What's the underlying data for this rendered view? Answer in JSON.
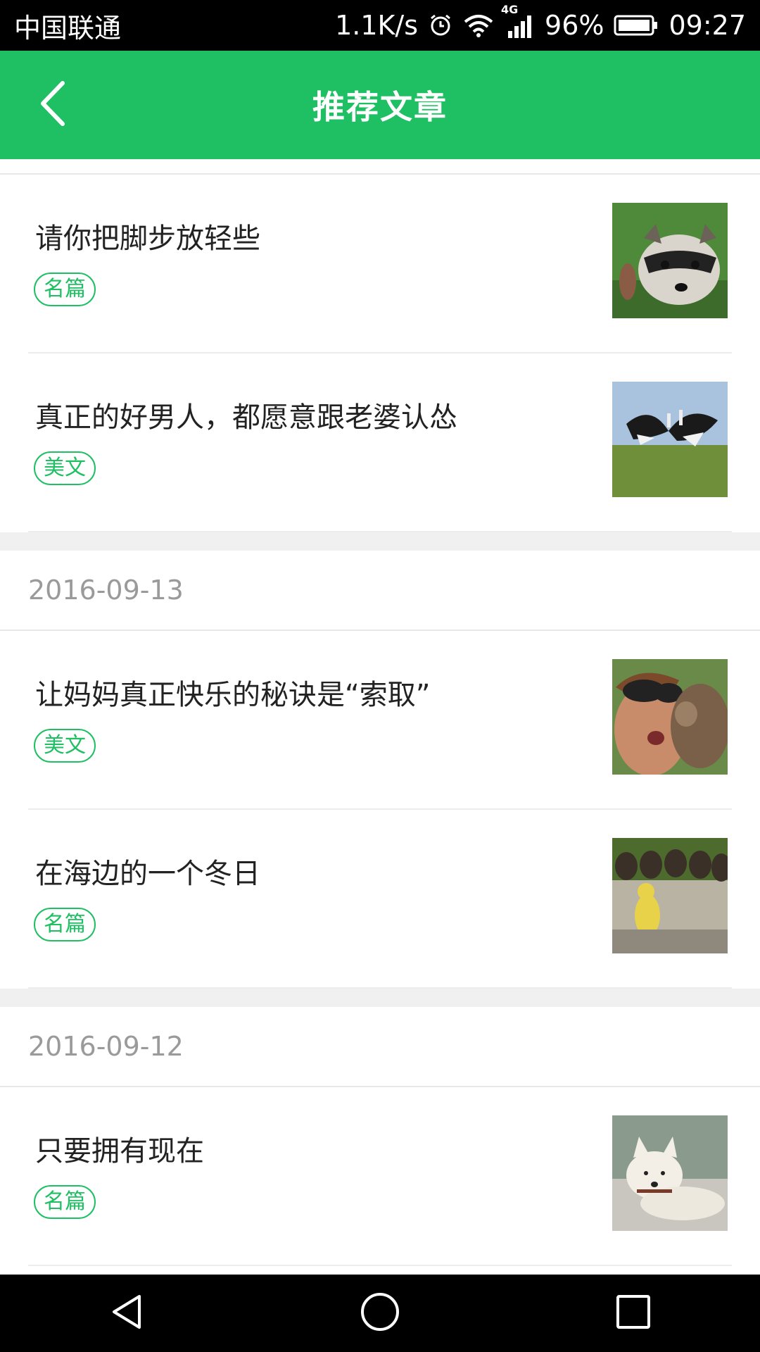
{
  "status_bar": {
    "carrier": "中国联通",
    "speed": "1.1K/s",
    "network": "4G",
    "battery": "96%",
    "time": "09:27",
    "icons": [
      "alarm-icon",
      "wifi-icon",
      "signal-icon",
      "battery-icon"
    ]
  },
  "app_bar": {
    "title": "推荐文章",
    "back_icon": "back-arrow-icon",
    "color": "#1fbf63"
  },
  "sections": [
    {
      "date": "",
      "articles": [
        {
          "title": "请你把脚步放轻些",
          "tag": "名篇",
          "thumbnail": "raccoon photo"
        },
        {
          "title": "真正的好男人，都愿意跟老婆认怂",
          "tag": "美文",
          "thumbnail": "birds photo"
        }
      ]
    },
    {
      "date": "2016-09-13",
      "articles": [
        {
          "title": "让妈妈真正快乐的秘诀是“索取”",
          "tag": "美文",
          "thumbnail": "woman and monkey photo"
        },
        {
          "title": "在海边的一个冬日",
          "tag": "名篇",
          "thumbnail": "ducklings photo"
        }
      ]
    },
    {
      "date": "2016-09-12",
      "articles": [
        {
          "title": "只要拥有现在",
          "tag": "名篇",
          "thumbnail": "dog photo"
        }
      ]
    }
  ],
  "nav_bar": {
    "icons": [
      "back-triangle-icon",
      "home-circle-icon",
      "recents-square-icon"
    ]
  }
}
